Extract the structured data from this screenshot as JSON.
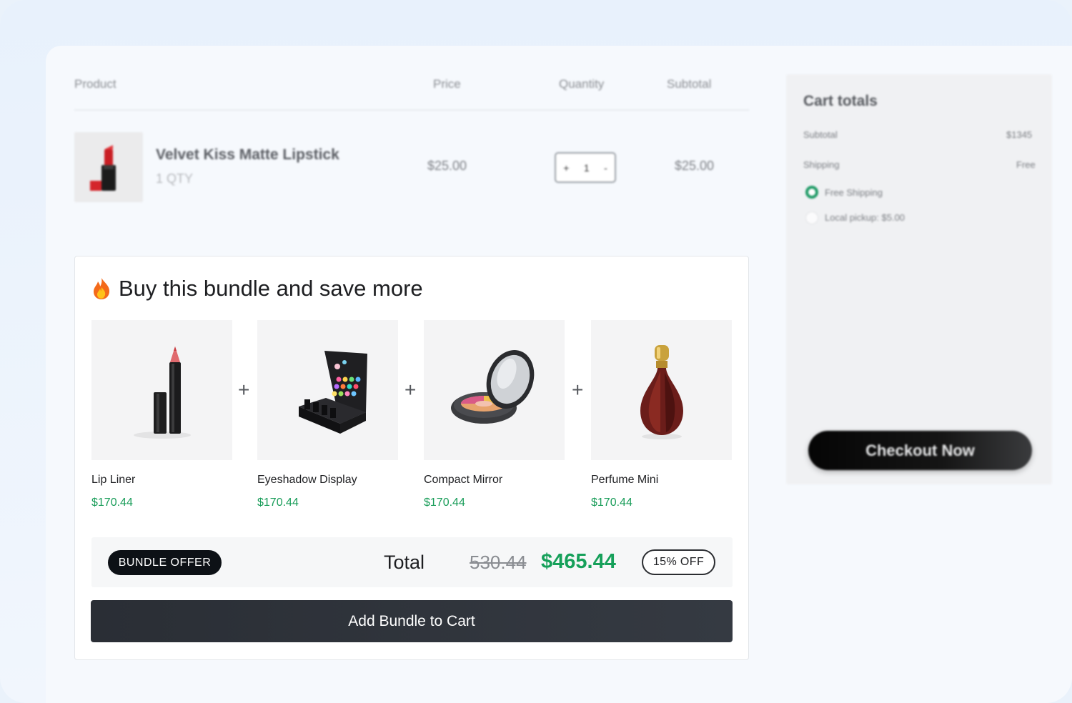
{
  "cart": {
    "headers": {
      "product": "Product",
      "price": "Price",
      "quantity": "Quantity",
      "subtotal": "Subtotal"
    },
    "item": {
      "name": "Velvet Kiss Matte Lipstick",
      "qty_label": "1 QTY",
      "price": "$25.00",
      "quantity": "1",
      "subtotal": "$25.00",
      "decrement_symbol": "+",
      "increment_symbol": "-"
    }
  },
  "totals": {
    "title": "Cart totals",
    "subtotal_label": "Subtotal",
    "subtotal_value": "$1345",
    "shipping_label": "Shipping",
    "shipping_value": "Free",
    "options": [
      {
        "label": "Free Shipping",
        "selected": true
      },
      {
        "label": "Local pickup: $5.00",
        "selected": false
      }
    ],
    "checkout_label": "Checkout Now"
  },
  "bundle": {
    "title": "Buy this bundle and save more",
    "plus_symbol": "+",
    "items": [
      {
        "name": "Lip Liner",
        "price": "$170.44",
        "icon": "lip-liner-image"
      },
      {
        "name": "Eyeshadow Display",
        "price": "$170.44",
        "icon": "eyeshadow-display-image"
      },
      {
        "name": "Compact Mirror",
        "price": "$170.44",
        "icon": "compact-mirror-image"
      },
      {
        "name": "Perfume Mini",
        "price": "$170.44",
        "icon": "perfume-image"
      }
    ],
    "offer_badge": "BUNDLE OFFER",
    "total_label": "Total",
    "original_total": "530.44",
    "discounted_total": "$465.44",
    "discount_badge": "15% OFF",
    "add_button": "Add Bundle to Cart"
  },
  "colors": {
    "accent_green": "#16a05a",
    "dark_button": "#2a2e35",
    "background": "#eaf2fb"
  }
}
